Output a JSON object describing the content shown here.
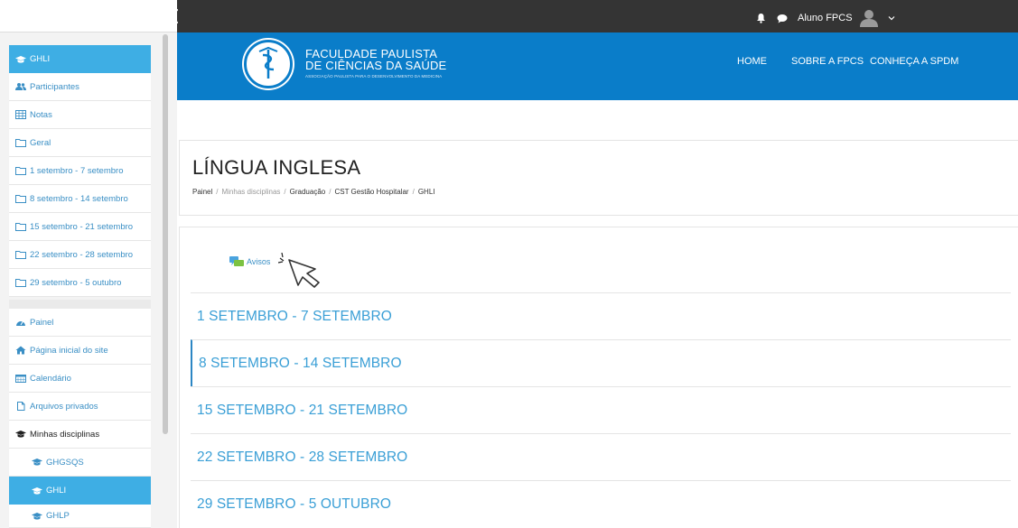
{
  "topbar": {
    "user_name": "Aluno FPCS"
  },
  "header": {
    "logo_seal": "SPDM",
    "logo_line1": "FACULDADE PAULISTA",
    "logo_line2": "DE CIÊNCIAS DA SAÚDE",
    "logo_line3": "ASSOCIAÇÃO PAULISTA PARA O DESENVOLVIMENTO DA MEDICINA",
    "nav": [
      "HOME",
      "SOBRE A FPCS",
      "CONHEÇA A SPDM"
    ]
  },
  "sidebar": {
    "course_items": [
      {
        "label": "GHLI",
        "icon": "graduation-cap-icon"
      },
      {
        "label": "Participantes",
        "icon": "users-icon"
      },
      {
        "label": "Notas",
        "icon": "table-icon"
      },
      {
        "label": "Geral",
        "icon": "folder-icon"
      },
      {
        "label": "1 setembro - 7 setembro",
        "icon": "folder-icon"
      },
      {
        "label": "8 setembro - 14 setembro",
        "icon": "folder-icon"
      },
      {
        "label": "15 setembro - 21 setembro",
        "icon": "folder-icon"
      },
      {
        "label": "22 setembro - 28 setembro",
        "icon": "folder-icon"
      },
      {
        "label": "29 setembro - 5 outubro",
        "icon": "folder-icon"
      }
    ],
    "site_items": [
      {
        "label": "Painel",
        "icon": "dashboard-icon"
      },
      {
        "label": "Página inicial do site",
        "icon": "home-icon"
      },
      {
        "label": "Calendário",
        "icon": "calendar-icon"
      },
      {
        "label": "Arquivos privados",
        "icon": "file-icon"
      },
      {
        "label": "Minhas disciplinas",
        "icon": "graduation-cap-icon"
      },
      {
        "label": "GHGSQS",
        "icon": "graduation-cap-icon"
      },
      {
        "label": "GHLI",
        "icon": "graduation-cap-icon"
      },
      {
        "label": "GHLP",
        "icon": "graduation-cap-icon"
      }
    ]
  },
  "main": {
    "title": "LÍNGUA INGLESA",
    "breadcrumb": [
      "Painel",
      "Minhas disciplinas",
      "Graduação",
      "CST Gestão Hospitalar",
      "GHLI"
    ],
    "avisos_label": "Avisos",
    "sections": [
      "1 SETEMBRO - 7 SETEMBRO",
      "8 SETEMBRO - 14 SETEMBRO",
      "15 SETEMBRO - 21 SETEMBRO",
      "22 SETEMBRO - 28 SETEMBRO",
      "29 SETEMBRO - 5 OUTUBRO"
    ]
  },
  "colors": {
    "header_blue": "#0a7dc9",
    "sidebar_active": "#3eaee4",
    "link_blue": "#3a8fc5",
    "topbar": "#343434"
  }
}
